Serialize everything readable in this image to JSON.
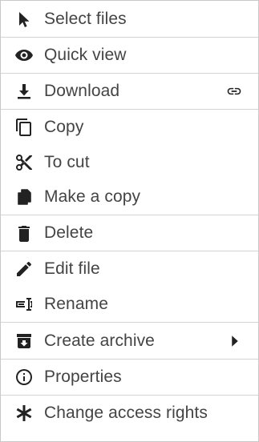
{
  "menu": {
    "items": [
      {
        "label": "Select files",
        "icon": "cursor-arrow-icon"
      },
      {
        "label": "Quick view",
        "icon": "eye-icon"
      },
      {
        "label": "Download",
        "icon": "download-icon",
        "secondary_icon": "link-icon"
      },
      {
        "label": "Copy",
        "icon": "copy-icon"
      },
      {
        "label": "To cut",
        "icon": "scissors-icon"
      },
      {
        "label": "Make a copy",
        "icon": "duplicate-file-icon"
      },
      {
        "label": "Delete",
        "icon": "trash-icon"
      },
      {
        "label": "Edit file",
        "icon": "pencil-icon"
      },
      {
        "label": "Rename",
        "icon": "rename-icon"
      },
      {
        "label": "Create archive",
        "icon": "archive-icon",
        "secondary_icon": "submenu-arrow-icon"
      },
      {
        "label": "Properties",
        "icon": "info-icon"
      },
      {
        "label": "Change access rights",
        "icon": "asterisk-icon"
      }
    ]
  },
  "colors": {
    "text": "#444444",
    "icon": "#222222",
    "separator": "#d4d4d4",
    "border": "#c9c9c9",
    "background": "#ffffff"
  }
}
